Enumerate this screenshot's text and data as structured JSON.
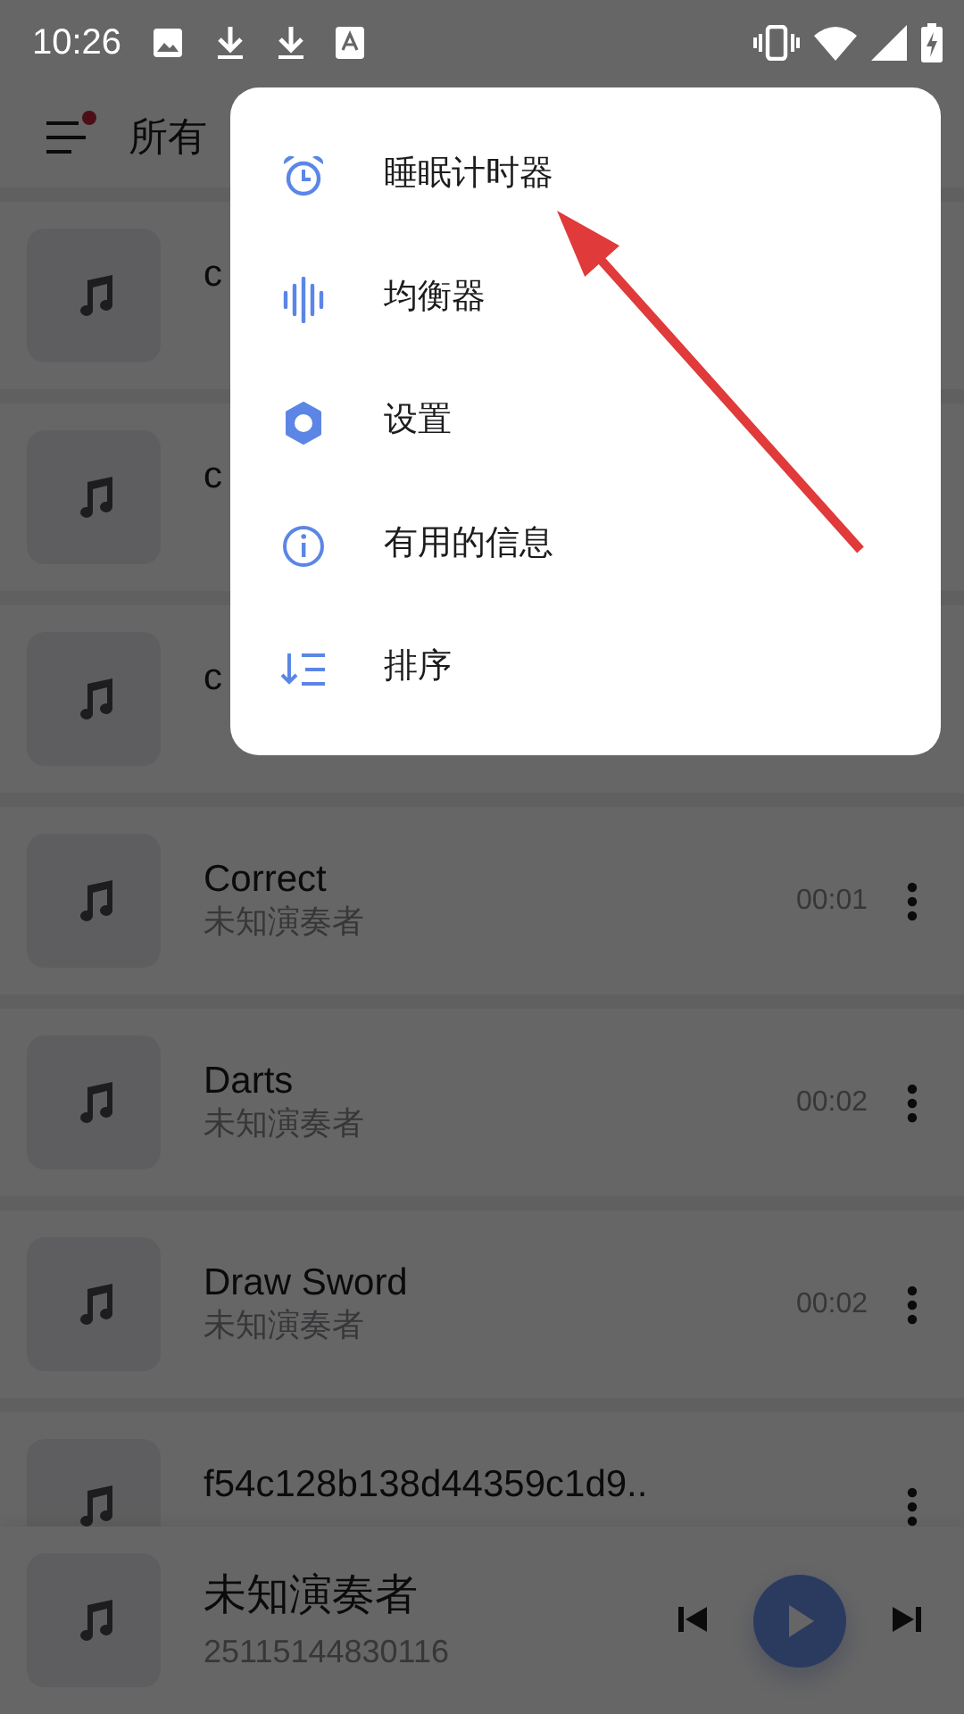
{
  "status_bar": {
    "time": "10:26"
  },
  "app_bar": {
    "title": "所有",
    "has_notification": true
  },
  "songs": [
    {
      "title": "c"
    },
    {
      "title": "c"
    },
    {
      "title": "c"
    },
    {
      "title": "Correct",
      "artist": "未知演奏者",
      "duration": "00:01",
      "more_button": true
    },
    {
      "title": "Darts",
      "artist": "未知演奏者",
      "duration": "00:02",
      "more_button": true
    },
    {
      "title": "Draw Sword",
      "artist": "未知演奏者",
      "duration": "00:02",
      "more_button": true
    },
    {
      "title": "f54c128b138d44359c1d9..",
      "more_button": true
    }
  ],
  "player": {
    "title": "未知演奏者",
    "subtitle": "25115144830116",
    "playing": false
  },
  "menu": {
    "items": [
      {
        "kind": "alarm",
        "label": "睡眠计时器"
      },
      {
        "kind": "equalizer",
        "label": "均衡器"
      },
      {
        "kind": "settings",
        "label": "设置"
      },
      {
        "kind": "info",
        "label": "有用的信息"
      },
      {
        "kind": "sort",
        "label": "排序"
      }
    ]
  }
}
